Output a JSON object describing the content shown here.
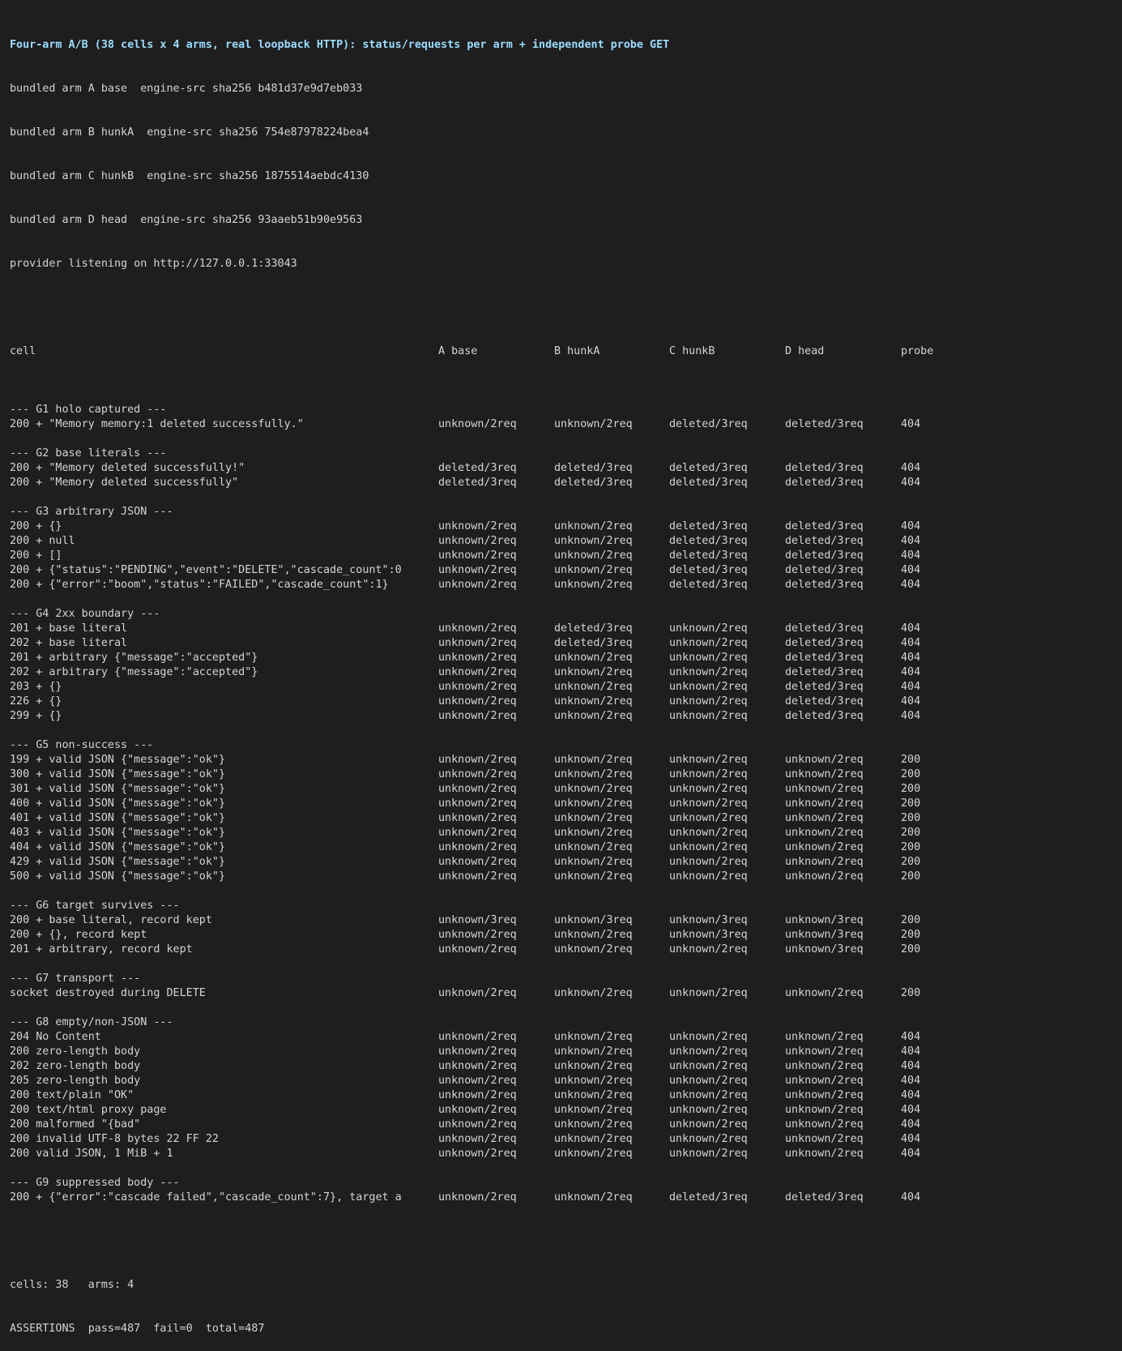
{
  "title": "Four-arm A/B (38 cells x 4 arms, real loopback HTTP): status/requests per arm + independent probe GET",
  "intro": [
    "bundled arm A base  engine-src sha256 b481d37e9d7eb033",
    "bundled arm B hunkA  engine-src sha256 754e87978224bea4",
    "bundled arm C hunkB  engine-src sha256 1875514aebdc4130",
    "bundled arm D head  engine-src sha256 93aaeb51b90e9563",
    "provider listening on http://127.0.0.1:33043"
  ],
  "header": [
    "cell",
    "A base",
    "B hunkA",
    "C hunkB",
    "D head",
    "probe"
  ],
  "groups": [
    {
      "label": "--- G1 holo captured ---",
      "rows": [
        [
          "200 + \"Memory memory:1 deleted successfully.\"",
          "unknown/2req",
          "unknown/2req",
          "deleted/3req",
          "deleted/3req",
          "404"
        ]
      ]
    },
    {
      "label": "--- G2 base literals ---",
      "rows": [
        [
          "200 + \"Memory deleted successfully!\"",
          "deleted/3req",
          "deleted/3req",
          "deleted/3req",
          "deleted/3req",
          "404"
        ],
        [
          "200 + \"Memory deleted successfully\"",
          "deleted/3req",
          "deleted/3req",
          "deleted/3req",
          "deleted/3req",
          "404"
        ]
      ]
    },
    {
      "label": "--- G3 arbitrary JSON ---",
      "rows": [
        [
          "200 + {}",
          "unknown/2req",
          "unknown/2req",
          "deleted/3req",
          "deleted/3req",
          "404"
        ],
        [
          "200 + null",
          "unknown/2req",
          "unknown/2req",
          "deleted/3req",
          "deleted/3req",
          "404"
        ],
        [
          "200 + []",
          "unknown/2req",
          "unknown/2req",
          "deleted/3req",
          "deleted/3req",
          "404"
        ],
        [
          "200 + {\"status\":\"PENDING\",\"event\":\"DELETE\",\"cascade_count\":0",
          "unknown/2req",
          "unknown/2req",
          "deleted/3req",
          "deleted/3req",
          "404"
        ],
        [
          "200 + {\"error\":\"boom\",\"status\":\"FAILED\",\"cascade_count\":1}",
          "unknown/2req",
          "unknown/2req",
          "deleted/3req",
          "deleted/3req",
          "404"
        ]
      ]
    },
    {
      "label": "--- G4 2xx boundary ---",
      "rows": [
        [
          "201 + base literal",
          "unknown/2req",
          "deleted/3req",
          "unknown/2req",
          "deleted/3req",
          "404"
        ],
        [
          "202 + base literal",
          "unknown/2req",
          "deleted/3req",
          "unknown/2req",
          "deleted/3req",
          "404"
        ],
        [
          "201 + arbitrary {\"message\":\"accepted\"}",
          "unknown/2req",
          "unknown/2req",
          "unknown/2req",
          "deleted/3req",
          "404"
        ],
        [
          "202 + arbitrary {\"message\":\"accepted\"}",
          "unknown/2req",
          "unknown/2req",
          "unknown/2req",
          "deleted/3req",
          "404"
        ],
        [
          "203 + {}",
          "unknown/2req",
          "unknown/2req",
          "unknown/2req",
          "deleted/3req",
          "404"
        ],
        [
          "226 + {}",
          "unknown/2req",
          "unknown/2req",
          "unknown/2req",
          "deleted/3req",
          "404"
        ],
        [
          "299 + {}",
          "unknown/2req",
          "unknown/2req",
          "unknown/2req",
          "deleted/3req",
          "404"
        ]
      ]
    },
    {
      "label": "--- G5 non-success ---",
      "rows": [
        [
          "199 + valid JSON {\"message\":\"ok\"}",
          "unknown/2req",
          "unknown/2req",
          "unknown/2req",
          "unknown/2req",
          "200"
        ],
        [
          "300 + valid JSON {\"message\":\"ok\"}",
          "unknown/2req",
          "unknown/2req",
          "unknown/2req",
          "unknown/2req",
          "200"
        ],
        [
          "301 + valid JSON {\"message\":\"ok\"}",
          "unknown/2req",
          "unknown/2req",
          "unknown/2req",
          "unknown/2req",
          "200"
        ],
        [
          "400 + valid JSON {\"message\":\"ok\"}",
          "unknown/2req",
          "unknown/2req",
          "unknown/2req",
          "unknown/2req",
          "200"
        ],
        [
          "401 + valid JSON {\"message\":\"ok\"}",
          "unknown/2req",
          "unknown/2req",
          "unknown/2req",
          "unknown/2req",
          "200"
        ],
        [
          "403 + valid JSON {\"message\":\"ok\"}",
          "unknown/2req",
          "unknown/2req",
          "unknown/2req",
          "unknown/2req",
          "200"
        ],
        [
          "404 + valid JSON {\"message\":\"ok\"}",
          "unknown/2req",
          "unknown/2req",
          "unknown/2req",
          "unknown/2req",
          "200"
        ],
        [
          "429 + valid JSON {\"message\":\"ok\"}",
          "unknown/2req",
          "unknown/2req",
          "unknown/2req",
          "unknown/2req",
          "200"
        ],
        [
          "500 + valid JSON {\"message\":\"ok\"}",
          "unknown/2req",
          "unknown/2req",
          "unknown/2req",
          "unknown/2req",
          "200"
        ]
      ]
    },
    {
      "label": "--- G6 target survives ---",
      "rows": [
        [
          "200 + base literal, record kept",
          "unknown/3req",
          "unknown/3req",
          "unknown/3req",
          "unknown/3req",
          "200"
        ],
        [
          "200 + {}, record kept",
          "unknown/2req",
          "unknown/2req",
          "unknown/3req",
          "unknown/3req",
          "200"
        ],
        [
          "201 + arbitrary, record kept",
          "unknown/2req",
          "unknown/2req",
          "unknown/2req",
          "unknown/3req",
          "200"
        ]
      ]
    },
    {
      "label": "--- G7 transport ---",
      "rows": [
        [
          "socket destroyed during DELETE",
          "unknown/2req",
          "unknown/2req",
          "unknown/2req",
          "unknown/2req",
          "200"
        ]
      ]
    },
    {
      "label": "--- G8 empty/non-JSON ---",
      "rows": [
        [
          "204 No Content",
          "unknown/2req",
          "unknown/2req",
          "unknown/2req",
          "unknown/2req",
          "404"
        ],
        [
          "200 zero-length body",
          "unknown/2req",
          "unknown/2req",
          "unknown/2req",
          "unknown/2req",
          "404"
        ],
        [
          "202 zero-length body",
          "unknown/2req",
          "unknown/2req",
          "unknown/2req",
          "unknown/2req",
          "404"
        ],
        [
          "205 zero-length body",
          "unknown/2req",
          "unknown/2req",
          "unknown/2req",
          "unknown/2req",
          "404"
        ],
        [
          "200 text/plain \"OK\"",
          "unknown/2req",
          "unknown/2req",
          "unknown/2req",
          "unknown/2req",
          "404"
        ],
        [
          "200 text/html proxy page",
          "unknown/2req",
          "unknown/2req",
          "unknown/2req",
          "unknown/2req",
          "404"
        ],
        [
          "200 malformed \"{bad\"",
          "unknown/2req",
          "unknown/2req",
          "unknown/2req",
          "unknown/2req",
          "404"
        ],
        [
          "200 invalid UTF-8 bytes 22 FF 22",
          "unknown/2req",
          "unknown/2req",
          "unknown/2req",
          "unknown/2req",
          "404"
        ],
        [
          "200 valid JSON, 1 MiB + 1",
          "unknown/2req",
          "unknown/2req",
          "unknown/2req",
          "unknown/2req",
          "404"
        ]
      ]
    },
    {
      "label": "--- G9 suppressed body ---",
      "rows": [
        [
          "200 + {\"error\":\"cascade failed\",\"cascade_count\":7}, target a",
          "unknown/2req",
          "unknown/2req",
          "deleted/3req",
          "deleted/3req",
          "404"
        ]
      ]
    }
  ],
  "footer": [
    "cells: 38   arms: 4",
    "ASSERTIONS  pass=487  fail=0  total=487"
  ],
  "colors": {
    "background": "#1e1e1e",
    "text": "#d4d4d4",
    "title": "#9cdcfe"
  }
}
